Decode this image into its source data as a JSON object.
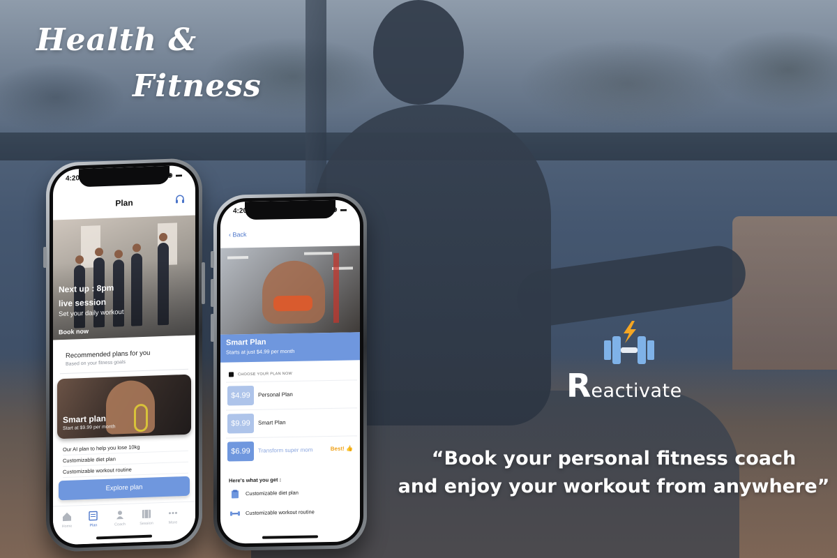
{
  "headline": {
    "line1": "Health &",
    "line2": "Fitness"
  },
  "brand": {
    "initial": "R",
    "rest": "eactivate",
    "icon": "dumbbell-lightning-icon"
  },
  "quote": {
    "line1": "“Book your personal fitness coach",
    "line2": "and enjoy your workout from anywhere”"
  },
  "phone1": {
    "status_time": "4:20",
    "title": "Plan",
    "headset_icon": "headset-icon",
    "hero": {
      "next_up": "Next up : 8pm",
      "session": "live session",
      "subtitle": "Set your daily workout",
      "cta": "Book now"
    },
    "recommended": {
      "title": "Recommended plans for you",
      "subtitle": "Based on your fitness goals"
    },
    "card": {
      "title": "Smart plan",
      "subtitle": "Start at $9.99 per month"
    },
    "features": [
      "Our AI plan to help you lose 10kg",
      "Customizable diet plan",
      "Customizable workout routine"
    ],
    "button": "Explore plan",
    "tabs": [
      {
        "label": "Home",
        "icon": "home-icon"
      },
      {
        "label": "Plan",
        "icon": "plan-icon",
        "active": true
      },
      {
        "label": "Coach",
        "icon": "coach-icon"
      },
      {
        "label": "Session",
        "icon": "session-icon"
      },
      {
        "label": "More",
        "icon": "more-icon"
      }
    ]
  },
  "phone2": {
    "status_time": "4:20",
    "back": "Back",
    "plan": {
      "title": "Smart Plan",
      "subtitle": "Starts at just $4.99 per month"
    },
    "choose": "CHOOSE YOUR PLAN NOW",
    "options": [
      {
        "price": "$4.99",
        "name": "Personal Plan"
      },
      {
        "price": "$9.99",
        "name": "Smart Plan"
      },
      {
        "price": "$6.99",
        "name": "Transform super mom",
        "badge": "Best!",
        "selected": true
      }
    ],
    "get_title": "Here's what you get :",
    "get_items": [
      "Customizable diet plan",
      "Customizable workout routine"
    ]
  },
  "colors": {
    "accent": "#6f97de",
    "best": "#f0a420"
  }
}
